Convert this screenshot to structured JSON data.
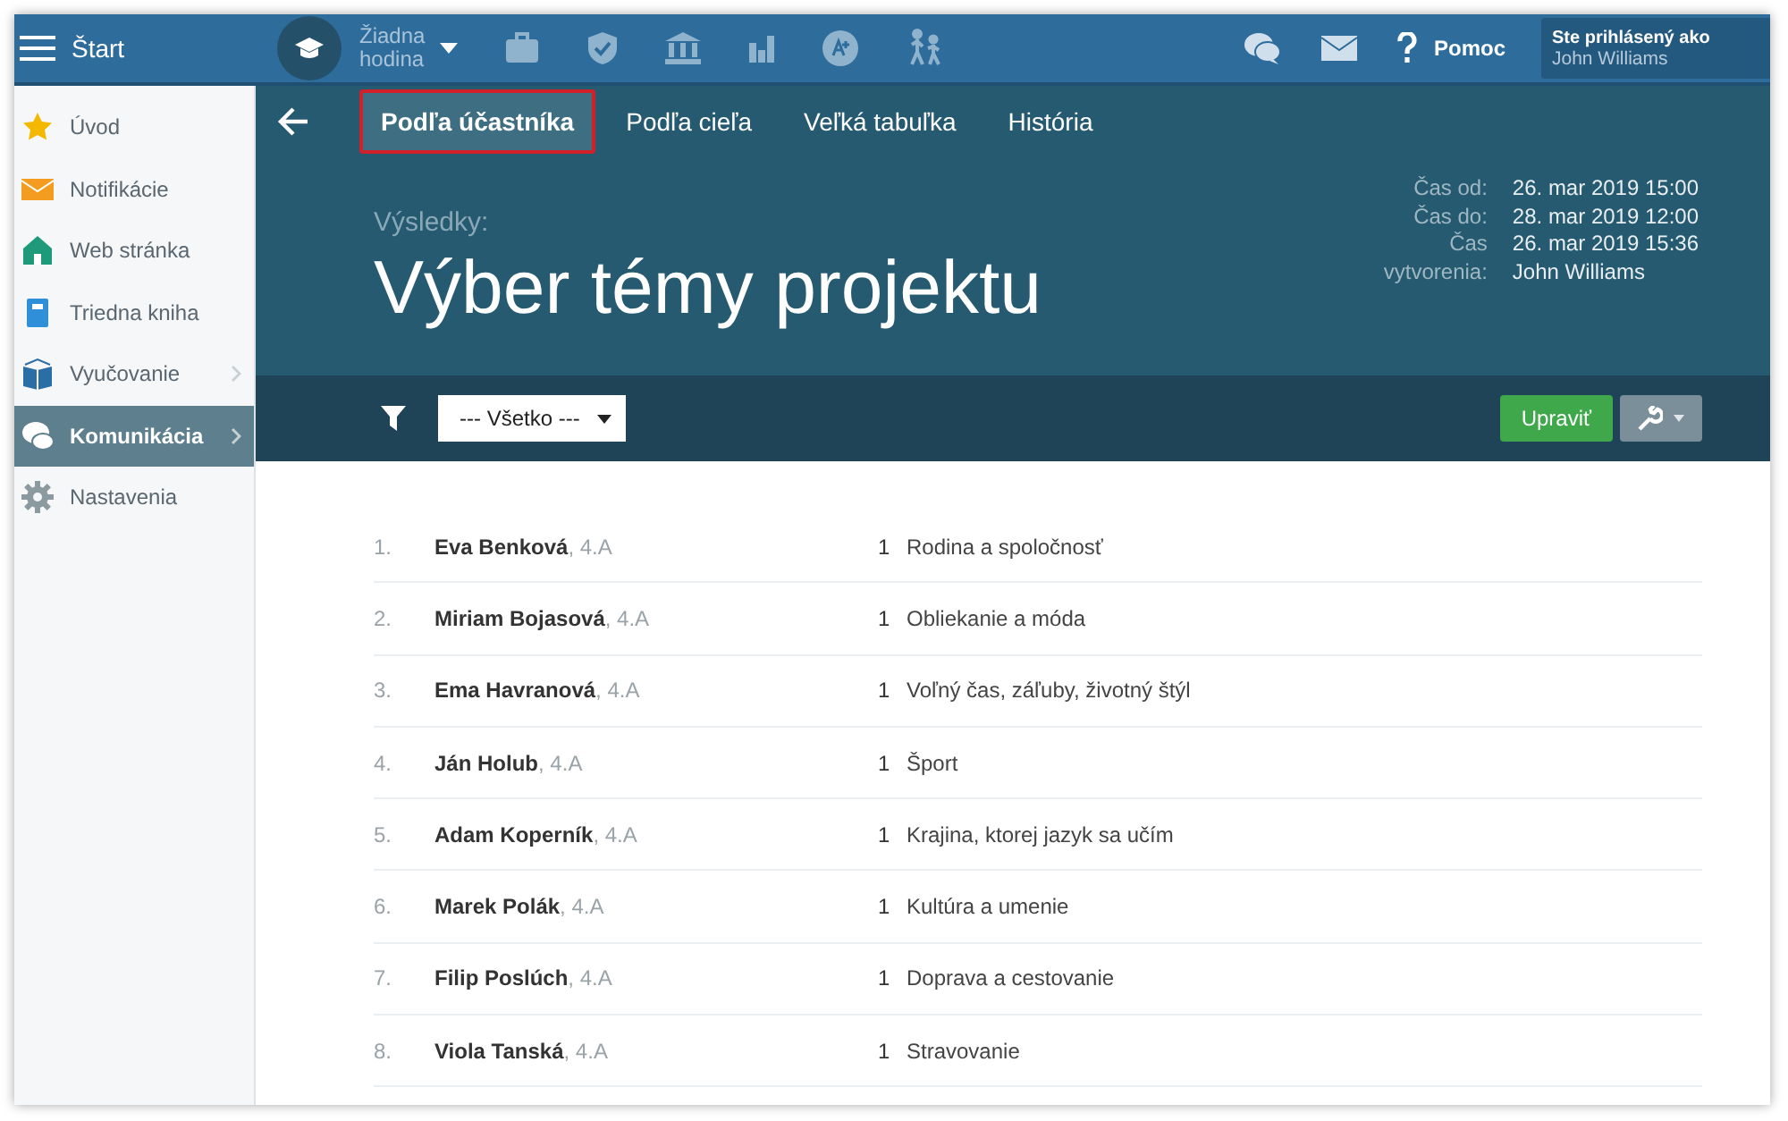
{
  "topbar": {
    "menu_label": "Štart",
    "lesson": {
      "line1": "Žiadna",
      "line2": "hodina"
    },
    "help": "Pomoc",
    "user": {
      "caption": "Ste prihlásený ako",
      "name": "John Williams"
    }
  },
  "sidebar": {
    "items": [
      {
        "label": "Úvod",
        "kind": "star",
        "selected": false,
        "expandable": false
      },
      {
        "label": "Notifikácie",
        "kind": "mail",
        "selected": false,
        "expandable": false
      },
      {
        "label": "Web stránka",
        "kind": "home",
        "selected": false,
        "expandable": false
      },
      {
        "label": "Triedna kniha",
        "kind": "book",
        "selected": false,
        "expandable": false
      },
      {
        "label": "Vyučovanie",
        "kind": "openbook",
        "selected": false,
        "expandable": true
      },
      {
        "label": "Komunikácia",
        "kind": "chat",
        "selected": true,
        "expandable": true
      },
      {
        "label": "Nastavenia",
        "kind": "gear",
        "selected": false,
        "expandable": false
      }
    ]
  },
  "tabs": [
    {
      "label": "Podľa účastníka",
      "selected": true
    },
    {
      "label": "Podľa cieľa",
      "selected": false
    },
    {
      "label": "Veľká tabuľka",
      "selected": false
    },
    {
      "label": "História",
      "selected": false
    }
  ],
  "header": {
    "caption": "Výsledky:",
    "title": "Výber témy projektu",
    "meta": [
      {
        "label": "Čas od:",
        "value": "26. mar 2019 15:00"
      },
      {
        "label": "Čas do:",
        "value": "28. mar 2019 12:00"
      },
      {
        "label": "Čas vytvorenia:",
        "value": "26. mar 2019 15:36\nJohn Williams"
      }
    ]
  },
  "filter": {
    "value": "--- Všetko ---"
  },
  "buttons": {
    "edit": "Upraviť"
  },
  "rows": [
    {
      "number": "1.",
      "name": "Eva Benková",
      "class": ", 4.A",
      "count": "1",
      "topic": "Rodina a spoločnosť"
    },
    {
      "number": "2.",
      "name": "Miriam Bojasová",
      "class": ", 4.A",
      "count": "1",
      "topic": "Obliekanie a móda"
    },
    {
      "number": "3.",
      "name": "Ema Havranová",
      "class": ", 4.A",
      "count": "1",
      "topic": "Voľný čas, záľuby, životný štýl"
    },
    {
      "number": "4.",
      "name": "Ján Holub",
      "class": ", 4.A",
      "count": "1",
      "topic": "Šport"
    },
    {
      "number": "5.",
      "name": "Adam Koperník",
      "class": ", 4.A",
      "count": "1",
      "topic": "Krajina, ktorej jazyk sa učím"
    },
    {
      "number": "6.",
      "name": "Marek Polák",
      "class": ", 4.A",
      "count": "1",
      "topic": "Kultúra a umenie"
    },
    {
      "number": "7.",
      "name": "Filip Poslúch",
      "class": ", 4.A",
      "count": "1",
      "topic": "Doprava a cestovanie"
    },
    {
      "number": "8.",
      "name": "Viola Tanská",
      "class": ", 4.A",
      "count": "1",
      "topic": "Stravovanie"
    }
  ]
}
